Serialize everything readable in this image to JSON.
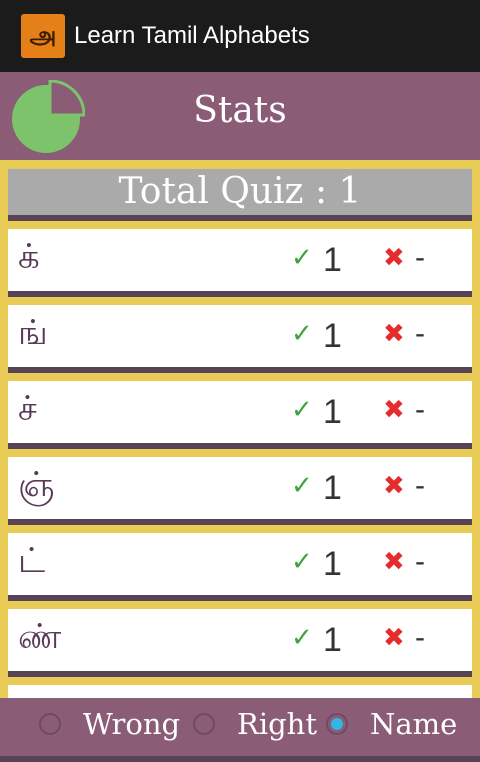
{
  "actionbar": {
    "title": "Learn Tamil Alphabets",
    "icon_glyph": "அ",
    "icon_name": "app-logo-icon"
  },
  "stats": {
    "title": "Stats",
    "icon_name": "pie-chart-icon"
  },
  "total_quiz": "Total Quiz : 1",
  "rows": [
    {
      "letter": "க்",
      "right": "1",
      "wrong": "-"
    },
    {
      "letter": "ங்",
      "right": "1",
      "wrong": "-"
    },
    {
      "letter": "ச்",
      "right": "1",
      "wrong": "-"
    },
    {
      "letter": "ஞ்",
      "right": "1",
      "wrong": "-"
    },
    {
      "letter": "ட்",
      "right": "1",
      "wrong": "-"
    },
    {
      "letter": "ண்",
      "right": "1",
      "wrong": "-"
    }
  ],
  "symbols": {
    "check": "✓",
    "cross": "✖"
  },
  "sort": {
    "options": [
      "Wrong",
      "Right",
      "Name"
    ],
    "selected": "Name"
  },
  "colors": {
    "actionbar": "#1b1b1b",
    "header": "#8a5c76",
    "background": "#e8cc55",
    "divider": "#584255",
    "check": "#3fa33f",
    "cross": "#e52b2b",
    "pie": "#7dc36b",
    "radio_selected": "#35b5e5"
  }
}
